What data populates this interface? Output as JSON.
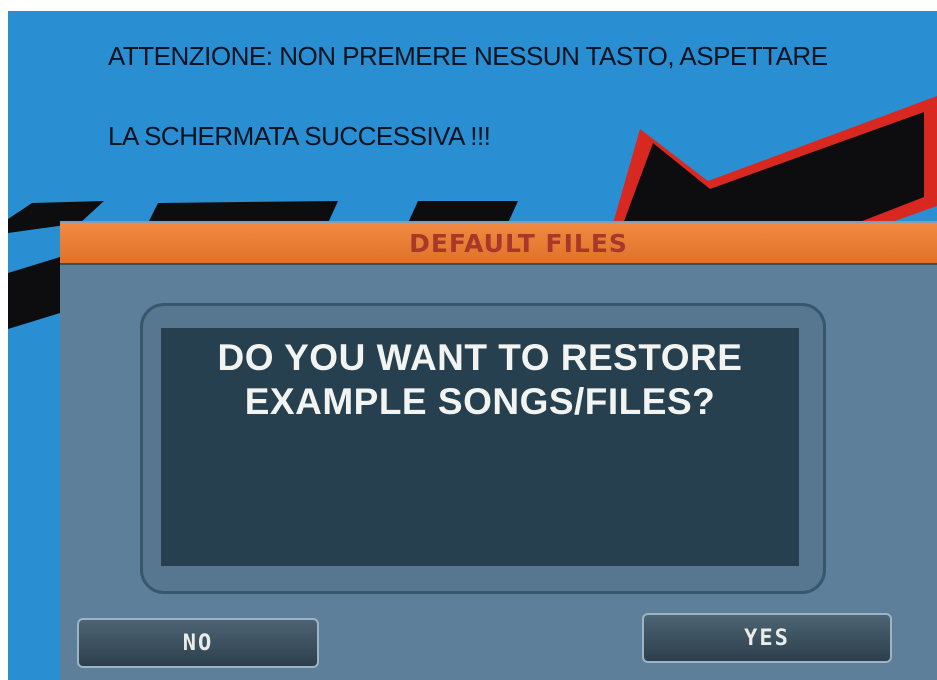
{
  "screen": {
    "notice_line_1": "ATTENZIONE: NON PREMERE NESSUN TASTO, ASPETTARE",
    "notice_line_2": "LA SCHERMATA SUCCESSIVA !!!",
    "background_color": "#2a8fd2"
  },
  "dialog": {
    "title": "DEFAULT FILES",
    "title_bar_color": "#f28a43",
    "message_lines": [
      "DO YOU WANT TO RESTORE",
      "EXAMPLE SONGS/FILES?"
    ],
    "buttons": {
      "no_label": "NO",
      "yes_label": "YES"
    }
  }
}
